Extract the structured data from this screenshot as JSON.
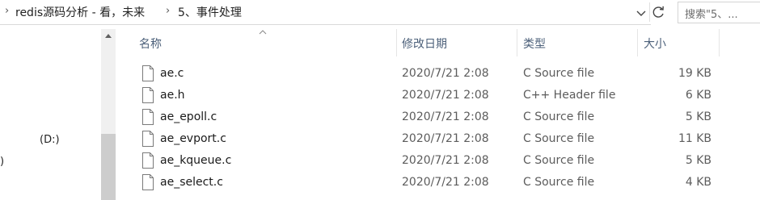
{
  "address": {
    "crumbs": [
      "redis源码分析 - 看，未来",
      "5、事件处理"
    ]
  },
  "search": {
    "placeholder": "搜索\"5、..."
  },
  "nav": {
    "drive_label": "(D:)",
    "partial_label": ")"
  },
  "columns": {
    "name": "名称",
    "date": "修改日期",
    "type": "类型",
    "size": "大小"
  },
  "files": [
    {
      "name": "ae.c",
      "date": "2020/7/21 2:08",
      "type": "C Source file",
      "size": "19 KB"
    },
    {
      "name": "ae.h",
      "date": "2020/7/21 2:08",
      "type": "C++ Header file",
      "size": "6 KB"
    },
    {
      "name": "ae_epoll.c",
      "date": "2020/7/21 2:08",
      "type": "C Source file",
      "size": "5 KB"
    },
    {
      "name": "ae_evport.c",
      "date": "2020/7/21 2:08",
      "type": "C Source file",
      "size": "11 KB"
    },
    {
      "name": "ae_kqueue.c",
      "date": "2020/7/21 2:08",
      "type": "C Source file",
      "size": "5 KB"
    },
    {
      "name": "ae_select.c",
      "date": "2020/7/21 2:08",
      "type": "C Source file",
      "size": "4 KB"
    }
  ],
  "colors": {
    "header_text": "#4c607a",
    "detail_text": "#5c5c5c"
  }
}
